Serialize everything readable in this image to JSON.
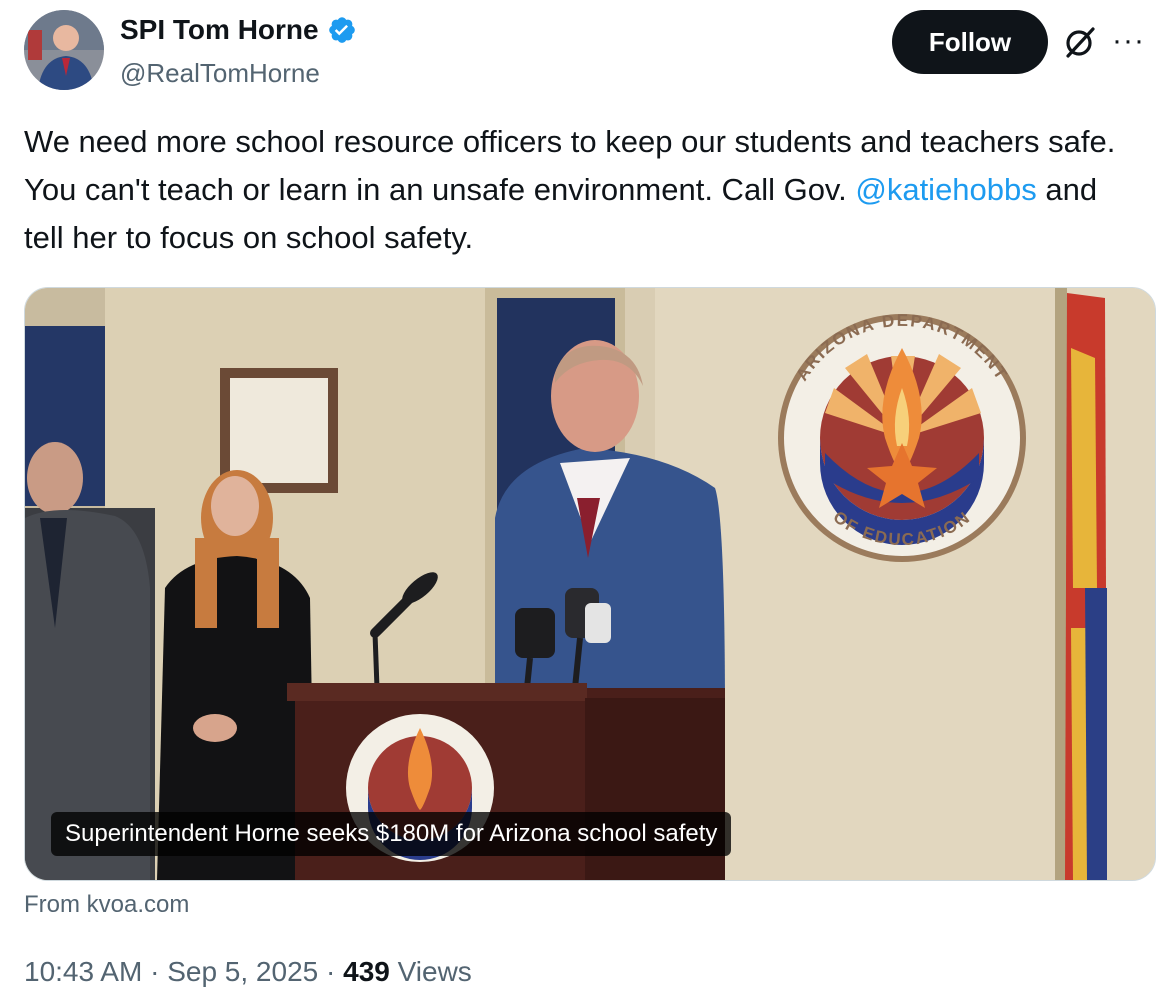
{
  "author": {
    "name": "SPI Tom Horne",
    "handle": "@RealTomHorne",
    "avatar_icon": "profile-photo",
    "verified_icon": "verified-badge-icon",
    "verified_color": "#1d9bf0"
  },
  "actions": {
    "follow_label": "Follow",
    "grok_icon": "grok-icon",
    "more_icon": "more-icon",
    "more_label": "···"
  },
  "tweet": {
    "text_before": "We need more school resource officers to keep our students and teachers safe. You can't teach or learn in an unsafe environment. Call Gov. ",
    "mention": "@katiehobbs",
    "text_after": " and tell her to focus on school safety."
  },
  "card": {
    "caption": "Superintendent Horne seeks $180M for Arizona school safety",
    "seal_text_top": "ARIZONA DEPARTMENT",
    "seal_text_bottom": "OF EDUCATION",
    "source": "From kvoa.com"
  },
  "meta": {
    "time": "10:43 AM",
    "sep1": " · ",
    "date": "Sep 5, 2025",
    "sep2": " · ",
    "views_count": "439",
    "views_label": " Views"
  },
  "colors": {
    "text": "#0f1419",
    "secondary": "#536471",
    "link": "#1d9bf0",
    "follow_bg": "#0f1419"
  }
}
